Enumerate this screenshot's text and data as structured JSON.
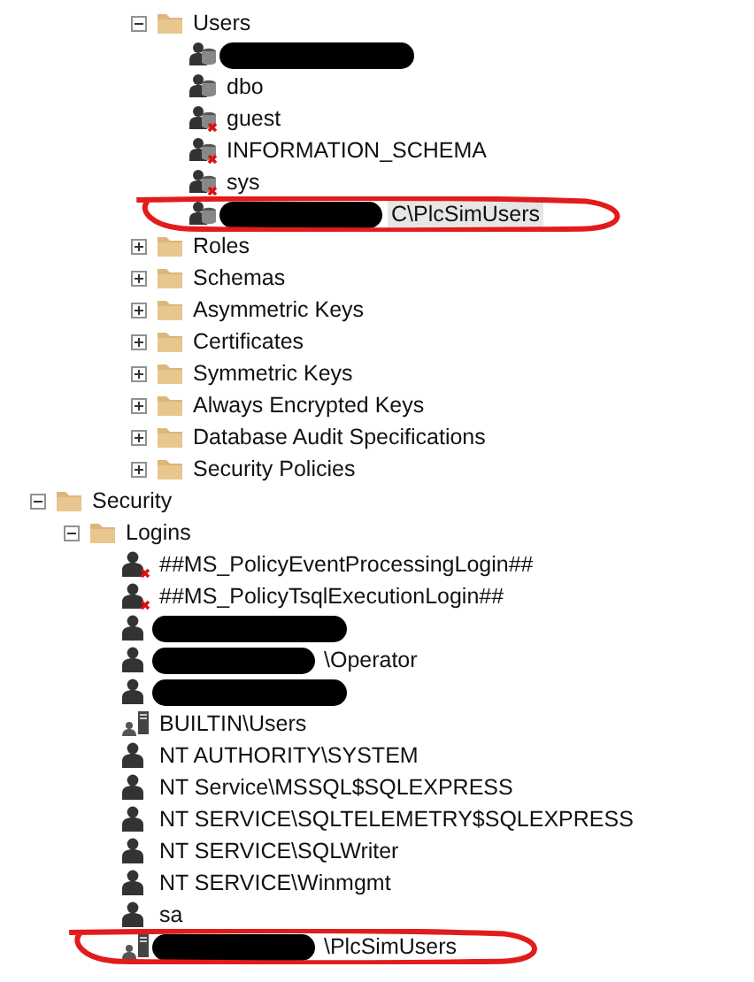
{
  "cut_branch": [
    {
      "kind": "folder",
      "label": "Users",
      "expanded": true,
      "children": [
        {
          "kind": "db_user",
          "redacted": true,
          "disabled": false
        },
        {
          "kind": "db_user",
          "label": "dbo",
          "disabled": false
        },
        {
          "kind": "db_user",
          "label": "guest",
          "disabled": true
        },
        {
          "kind": "db_user",
          "label": "INFORMATION_SCHEMA",
          "disabled": true
        },
        {
          "kind": "db_user",
          "label": "sys",
          "disabled": true
        },
        {
          "kind": "db_user",
          "label": "C\\PlcSimUsers",
          "redacted": true,
          "disabled": false,
          "selected": true,
          "circled": true
        }
      ]
    },
    {
      "kind": "folder",
      "label": "Roles",
      "expanded": false
    },
    {
      "kind": "folder",
      "label": "Schemas",
      "expanded": false
    },
    {
      "kind": "folder",
      "label": "Asymmetric Keys",
      "expanded": false
    },
    {
      "kind": "folder",
      "label": "Certificates",
      "expanded": false
    },
    {
      "kind": "folder",
      "label": "Symmetric Keys",
      "expanded": false
    },
    {
      "kind": "folder",
      "label": "Always Encrypted Keys",
      "expanded": false
    },
    {
      "kind": "folder",
      "label": "Database Audit Specifications",
      "expanded": false
    },
    {
      "kind": "folder",
      "label": "Security Policies",
      "expanded": false
    }
  ],
  "tree": [
    {
      "kind": "folder",
      "label": "Security",
      "expanded": true,
      "children": [
        {
          "kind": "folder",
          "label": "Logins",
          "expanded": true,
          "children": [
            {
              "kind": "login",
              "label": "##MS_PolicyEventProcessingLogin##",
              "disabled": true
            },
            {
              "kind": "login",
              "label": "##MS_PolicyTsqlExecutionLogin##",
              "disabled": true
            },
            {
              "kind": "login",
              "redacted": true,
              "disabled": false
            },
            {
              "kind": "login",
              "label": "\\Operator",
              "redacted": true,
              "disabled": false
            },
            {
              "kind": "login",
              "redacted": true,
              "disabled": false
            },
            {
              "kind": "group",
              "label": "BUILTIN\\Users"
            },
            {
              "kind": "login",
              "label": "NT AUTHORITY\\SYSTEM",
              "disabled": false
            },
            {
              "kind": "login",
              "label": "NT Service\\MSSQL$SQLEXPRESS",
              "disabled": false
            },
            {
              "kind": "login",
              "label": "NT SERVICE\\SQLTELEMETRY$SQLEXPRESS",
              "disabled": false
            },
            {
              "kind": "login",
              "label": "NT SERVICE\\SQLWriter",
              "disabled": false
            },
            {
              "kind": "login",
              "label": "NT SERVICE\\Winmgmt",
              "disabled": false
            },
            {
              "kind": "login",
              "label": "sa",
              "disabled": false
            },
            {
              "kind": "group",
              "label": "\\PlcSimUsers",
              "redacted": true,
              "circled": true
            }
          ]
        }
      ]
    }
  ]
}
